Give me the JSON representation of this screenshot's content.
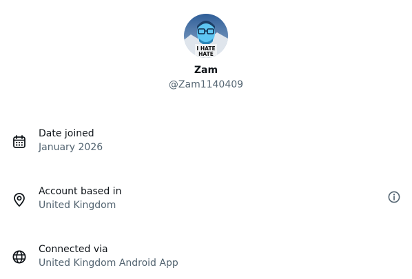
{
  "profile": {
    "display_name": "Zam",
    "handle": "@Zam1140409",
    "avatar_caption": "I HATE HATE"
  },
  "about": {
    "rows": [
      {
        "title": "Date joined",
        "value": "January 2026",
        "icon": "calendar-icon"
      },
      {
        "title": "Account based in",
        "value": "United Kingdom",
        "icon": "location-pin-icon",
        "info_icon": "info-icon"
      },
      {
        "title": "Connected via",
        "value": "United Kingdom Android App",
        "icon": "globe-icon"
      }
    ]
  },
  "colors": {
    "primary_text": "#0f1419",
    "secondary_text": "#536471",
    "avatar_sky": "#3d6ea8",
    "avatar_face": "#5ec6f2"
  }
}
